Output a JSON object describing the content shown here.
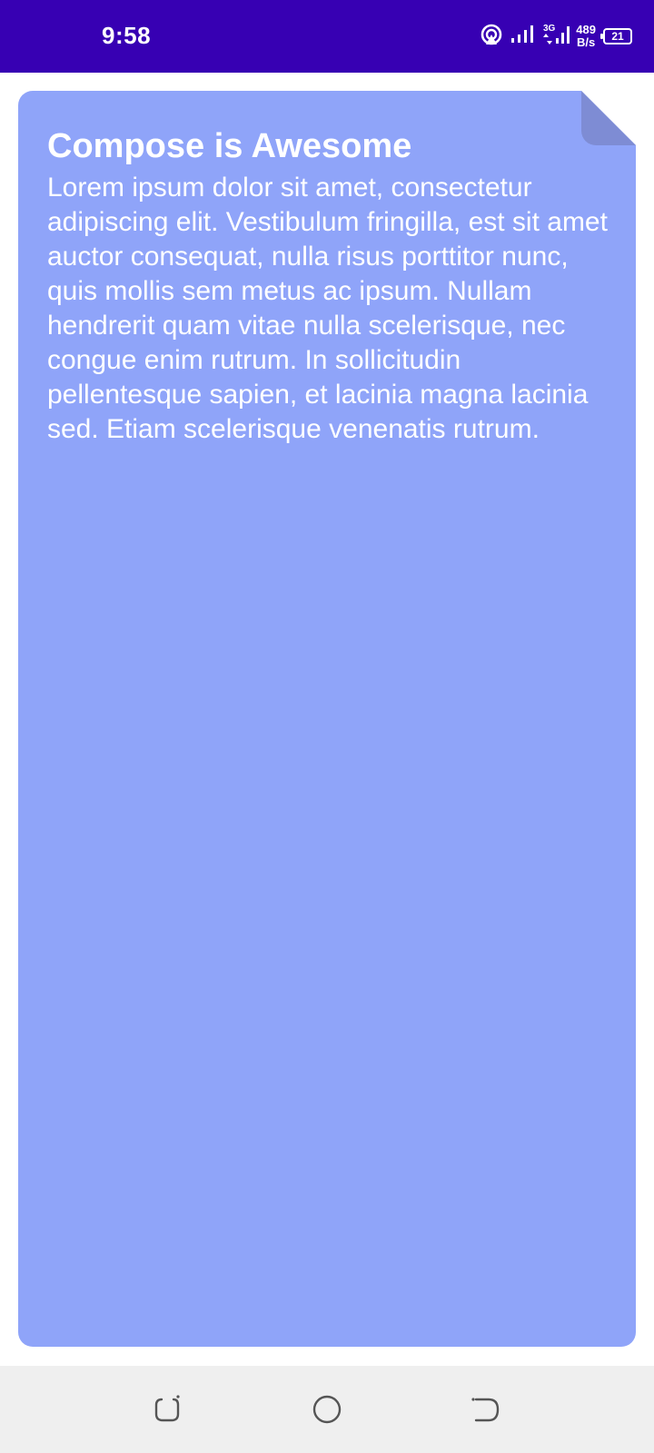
{
  "status_bar": {
    "time": "9:58",
    "network_speed_value": "489",
    "network_speed_unit": "B/s",
    "battery_level": "21",
    "icons": [
      "hotspot-icon",
      "signal-icon",
      "3g-signal-icon",
      "battery-icon"
    ],
    "background_color": "#3700B3"
  },
  "note_card": {
    "title": "Compose is Awesome",
    "body": "Lorem ipsum dolor sit amet, consectetur adipiscing elit. Vestibulum fringilla, est sit amet auctor consequat, nulla risus porttitor nunc, quis mollis sem metus ac ipsum. Nullam hendrerit quam vitae nulla scelerisque, nec congue enim rutrum. In sollicitudin pellentesque sapien, et lacinia magna lacinia sed. Etiam scelerisque venenatis rutrum.",
    "background_color": "#8FA4F9",
    "fold_color": "#7E8CD4"
  },
  "navigation_bar": {
    "buttons": [
      "recents-button",
      "home-button",
      "back-button"
    ],
    "background_color": "#EFEFEF"
  }
}
